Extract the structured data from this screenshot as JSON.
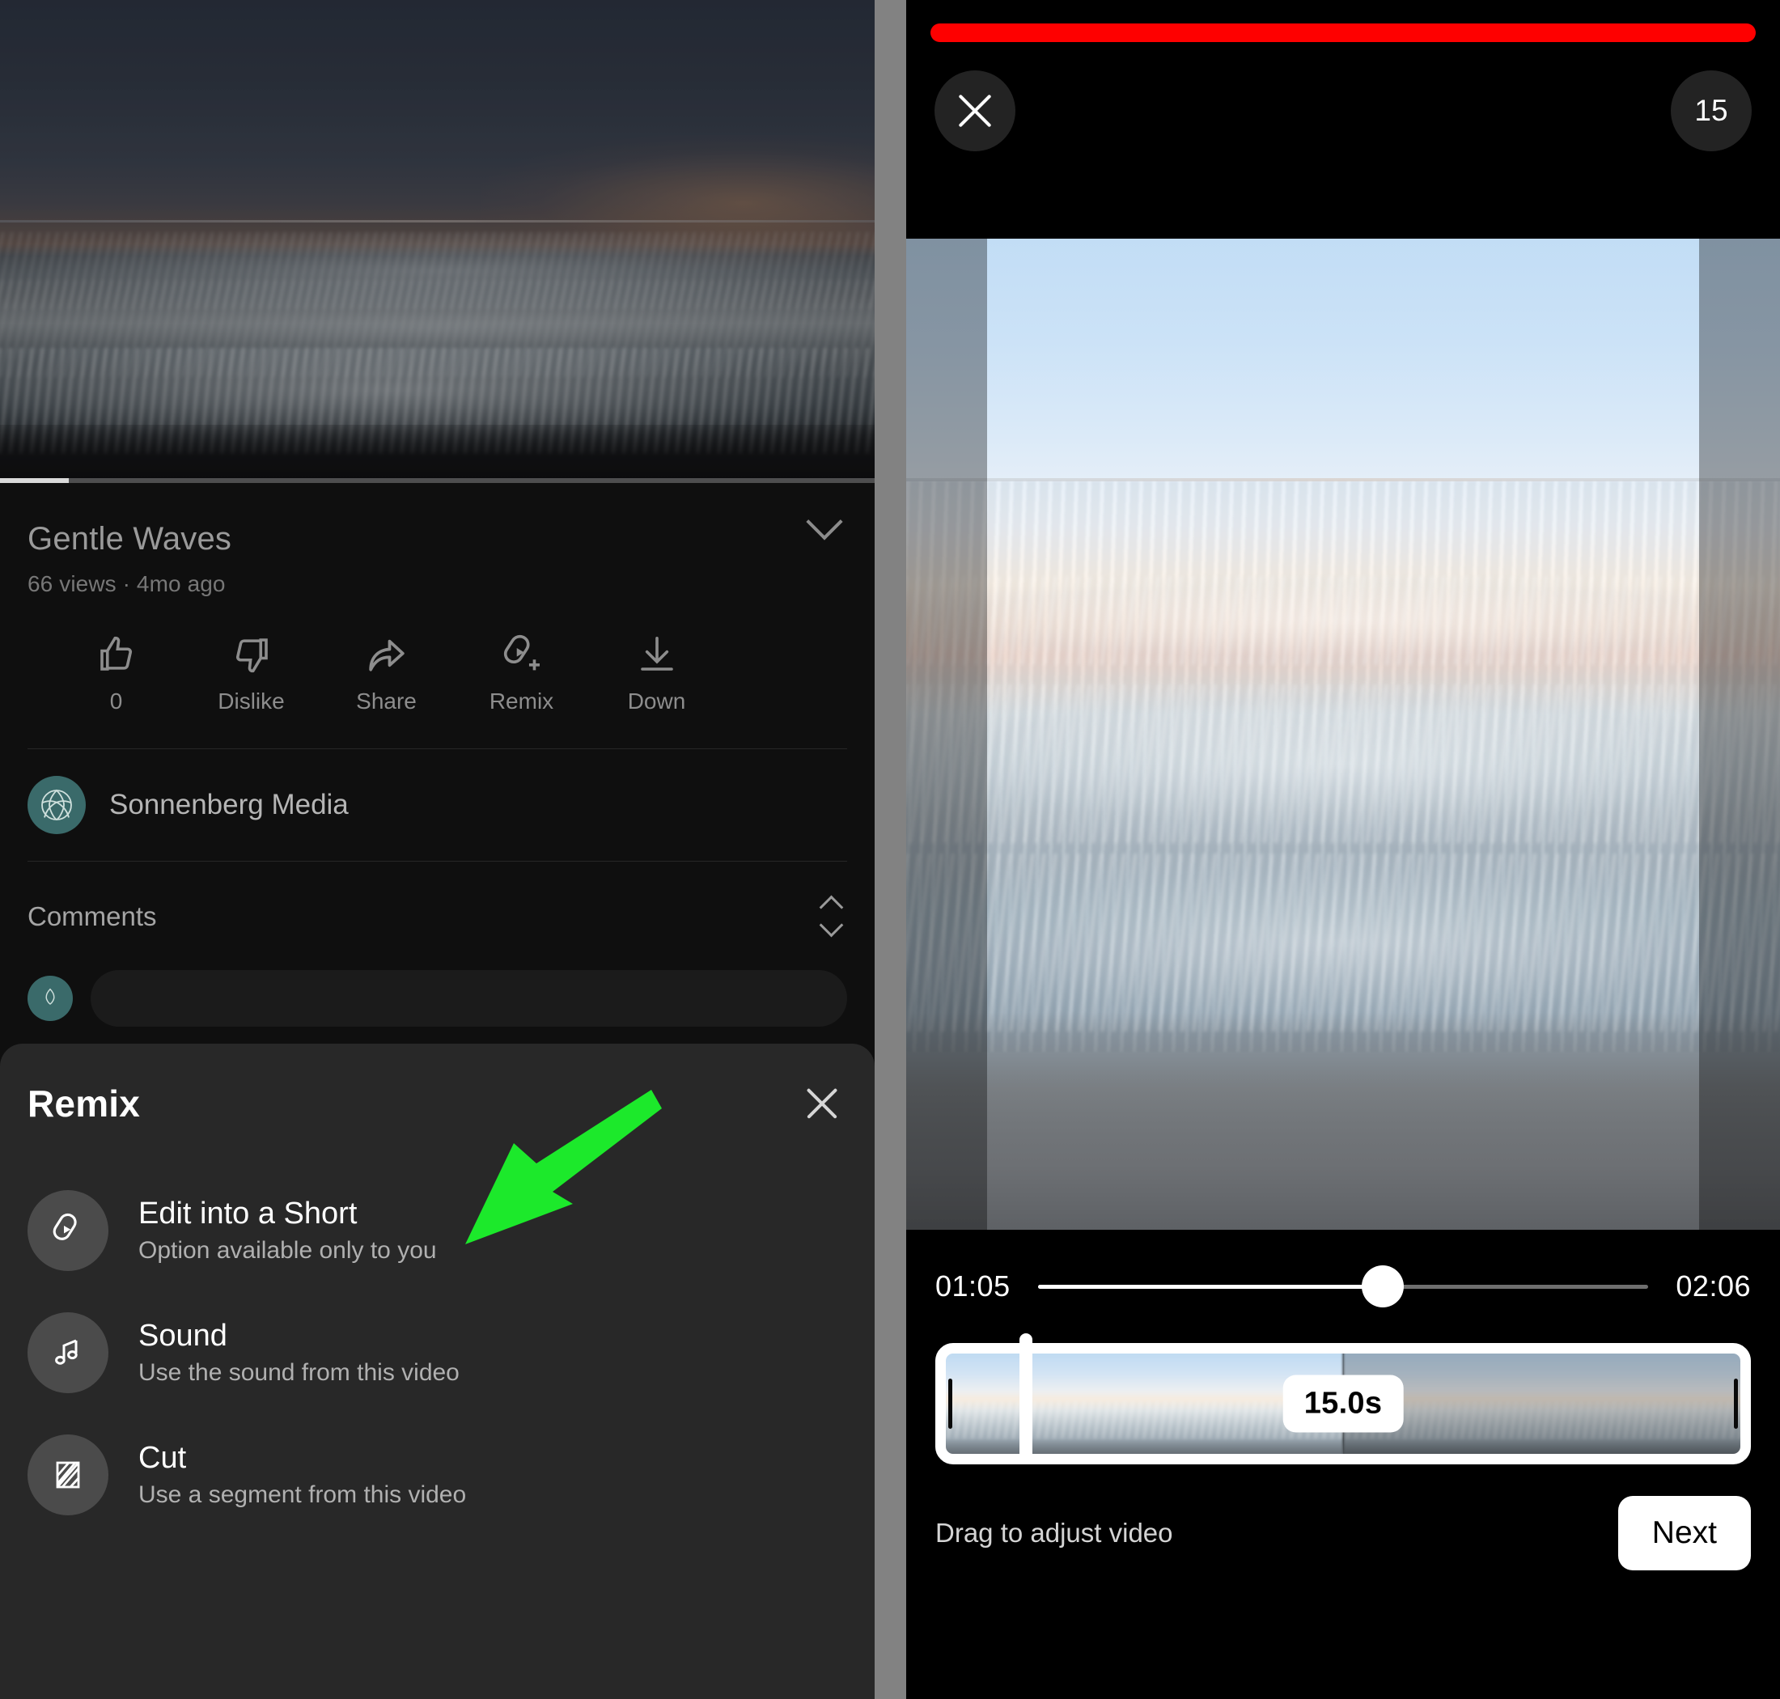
{
  "left": {
    "video": {
      "title": "Gentle Waves",
      "meta": "66 views · 4mo ago",
      "expand_icon": "chevron-down-icon",
      "progress_percent": 8
    },
    "actions": [
      {
        "label": "0",
        "icon": "thumbs-up-icon"
      },
      {
        "label": "Dislike",
        "icon": "thumbs-down-icon"
      },
      {
        "label": "Share",
        "icon": "share-arrow-icon"
      },
      {
        "label": "Remix",
        "icon": "remix-icon"
      },
      {
        "label": "Down",
        "icon": "download-icon"
      }
    ],
    "channel": {
      "name": "Sonnenberg Media",
      "avatar_icon": "channel-avatar-icon"
    },
    "comments": {
      "heading": "Comments",
      "sort_icon": "sort-icon"
    },
    "sheet": {
      "title": "Remix",
      "close_icon": "close-icon",
      "items": [
        {
          "title": "Edit into a Short",
          "subtitle": "Option available only to you",
          "icon": "edit-short-icon"
        },
        {
          "title": "Sound",
          "subtitle": "Use the sound from this video",
          "icon": "music-note-icon"
        },
        {
          "title": "Cut",
          "subtitle": "Use a segment from this video",
          "icon": "cut-segment-icon"
        }
      ]
    },
    "annotation": {
      "arrow_color": "#1ce92b",
      "points_to": "Edit into a Short"
    }
  },
  "right": {
    "recording_bar_color": "#fe0000",
    "topbar": {
      "close_icon": "close-icon",
      "duration_badge": "15"
    },
    "player": {
      "current_time": "01:05",
      "total_time": "02:06",
      "scrub_percent": 56.5
    },
    "timeline": {
      "segment_duration": "15.0s",
      "left_handle_icon": "trim-handle-icon",
      "right_handle_icon": "trim-handle-icon",
      "playhead_icon": "playhead-icon"
    },
    "footer": {
      "hint": "Drag to adjust video",
      "next_label": "Next"
    }
  }
}
